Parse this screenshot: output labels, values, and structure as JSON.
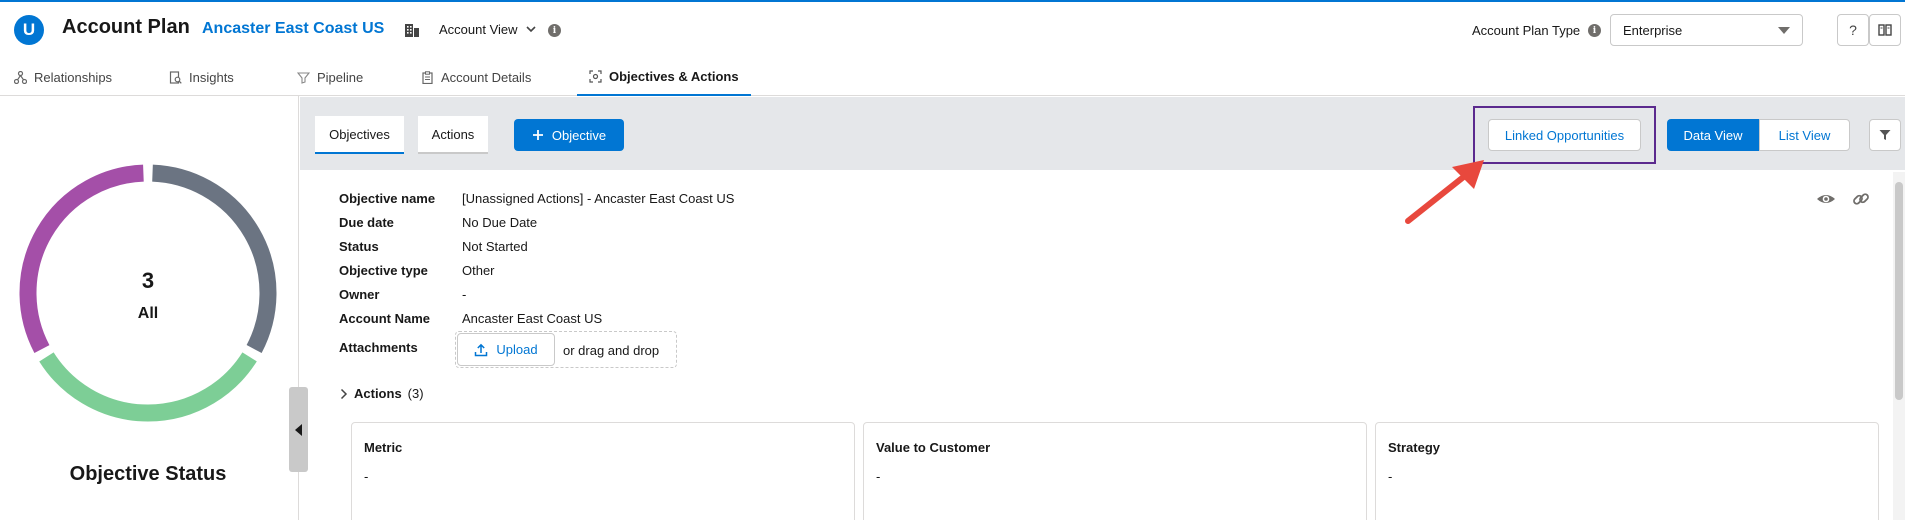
{
  "header": {
    "logo_letter": "U",
    "title": "Account Plan",
    "account_name": "Ancaster East Coast US",
    "view_label": "Account View",
    "plan_type_label": "Account Plan Type",
    "plan_type_value": "Enterprise",
    "help_label": "?"
  },
  "nav": {
    "tabs": [
      {
        "label": "Relationships",
        "icon": "relationships-icon"
      },
      {
        "label": "Insights",
        "icon": "insights-icon"
      },
      {
        "label": "Pipeline",
        "icon": "pipeline-icon"
      },
      {
        "label": "Account Details",
        "icon": "clipboard-icon"
      },
      {
        "label": "Objectives & Actions",
        "icon": "objectives-icon",
        "active": true
      }
    ]
  },
  "left_panel": {
    "count": "3",
    "count_label": "All",
    "title": "Objective Status",
    "segments": [
      {
        "color": "#6b7482",
        "fraction": 0.3333
      },
      {
        "color": "#7dce96",
        "fraction": 0.3333
      },
      {
        "color": "#a44fa8",
        "fraction": 0.3333
      }
    ]
  },
  "toolbar": {
    "tab_objectives": "Objectives",
    "tab_actions": "Actions",
    "add_objective": "Objective",
    "linked_opps": "Linked Opportunities",
    "data_view": "Data View",
    "list_view": "List View"
  },
  "details": [
    {
      "label": "Objective name",
      "value": "[Unassigned Actions] - Ancaster East Coast US"
    },
    {
      "label": "Due date",
      "value": "No Due Date"
    },
    {
      "label": "Status",
      "value": "Not Started"
    },
    {
      "label": "Objective type",
      "value": "Other"
    },
    {
      "label": "Owner",
      "value": "-"
    },
    {
      "label": "Account Name",
      "value": "Ancaster East Coast US"
    }
  ],
  "attachments": {
    "label": "Attachments",
    "upload": "Upload",
    "drag": "or drag and drop"
  },
  "actions_section": {
    "title": "Actions",
    "count": "(3)"
  },
  "cards": [
    {
      "title": "Metric",
      "value": "-"
    },
    {
      "title": "Value to Customer",
      "value": "-"
    },
    {
      "title": "Strategy",
      "value": "-"
    }
  ],
  "colors": {
    "brand": "#0176d3",
    "highlight": "#5b2a8e",
    "arrow": "#e8483d"
  }
}
